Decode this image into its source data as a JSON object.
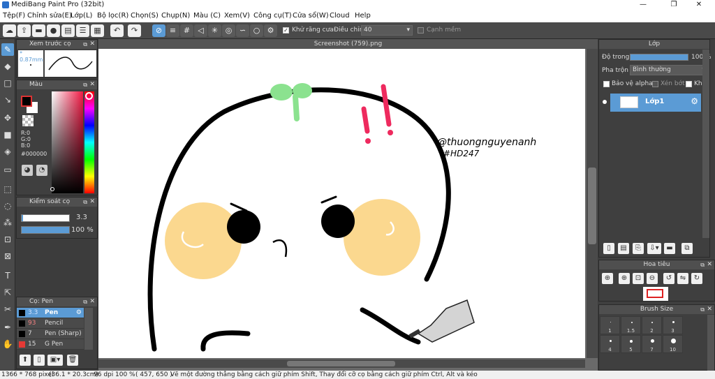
{
  "window": {
    "title": "MediBang Paint Pro (32bit)",
    "minimize": "—",
    "maximize": "❐",
    "close": "✕"
  },
  "menu": [
    "Tệp(F)",
    "Chỉnh sửa(E)",
    "Lớp(L)",
    "Bộ lọc(R)",
    "Chọn(S)",
    "Chụp(N)",
    "Màu (C)",
    "Xem(V)",
    "Công cụ(T)",
    "Cửa sổ(W)",
    "Cloud",
    "Help"
  ],
  "toolbar": {
    "antialias_label": "Khử răng cưa",
    "adjust_label": "Điều chỉnh",
    "adjust_value": "40",
    "snap_label": "Cạnh mềm"
  },
  "document": {
    "tab_title": "Screenshot (759).png"
  },
  "brush_preview": {
    "title": "Xem trước cọ",
    "size": "* 0.87mm"
  },
  "color_panel": {
    "title": "Màu",
    "r": "R:0",
    "g": "G:0",
    "b": "B:0",
    "hex": "#000000",
    "fg_color": "#000000",
    "bg_color": "#ffffff"
  },
  "brush_control": {
    "title": "Kiểm soát cọ",
    "size_value": "3.3",
    "opacity_value": "100 %",
    "opacity_fraction": 1.0
  },
  "brush_list": {
    "title": "Cọ: Pen",
    "items": [
      {
        "size": "3.3",
        "name": "Pen",
        "color": "#000000",
        "active": true
      },
      {
        "size": "93",
        "name": "Pencil",
        "color": "#000000",
        "active": false
      },
      {
        "size": "7",
        "name": "Pen (Sharp)",
        "color": "#000000",
        "active": false
      },
      {
        "size": "15",
        "name": "G Pen",
        "color": "#e53935",
        "active": false
      }
    ]
  },
  "layer_panel": {
    "title": "Lớp",
    "opacity_label": "Độ trong",
    "opacity_value": "100 %",
    "opacity_fraction": 1.0,
    "blend_label": "Pha trộn",
    "blend_value": "Bình thường",
    "protect_alpha": "Bảo vệ alpha",
    "clipping": "Xén bớt",
    "lock": "Khóa",
    "layers": [
      {
        "name": "Lớp1"
      }
    ]
  },
  "navigator": {
    "title": "Hoa tiêu"
  },
  "brush_size_panel": {
    "title": "Brush Size",
    "labels": [
      "1",
      "1.5",
      "2",
      "3",
      "4",
      "5",
      "7",
      "10"
    ]
  },
  "canvas_art": {
    "handle": "@thuongnguyenanh",
    "tag": "#HD247",
    "exclamation": "!!"
  },
  "status": {
    "size": "1366 * 768 pixel",
    "physical": "(36.1 * 20.3cm)",
    "dpi": "96 dpi",
    "zoom": "100 %",
    "coords": "( 457, 650 )",
    "hint": "Vẽ một đường thẳng bằng cách giữ phím Shift, Thay đổi cỡ cọ bằng cách giữ phím Ctrl, Alt và kéo"
  }
}
